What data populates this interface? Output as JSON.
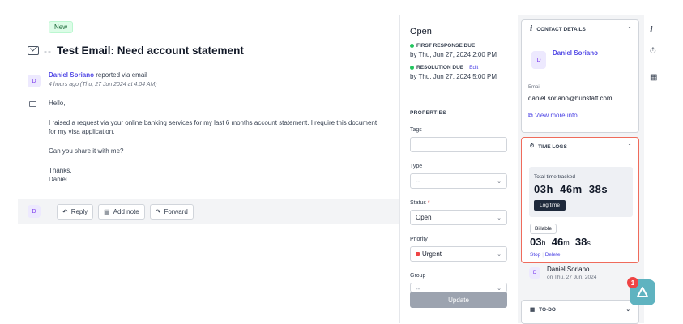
{
  "ticket": {
    "badge": "New",
    "subject": "Test Email: Need account statement",
    "reporter": {
      "initial": "D",
      "name": "Daniel Soriano",
      "action": " reported via email",
      "time": "4 hours ago (Thu, 27 Jun 2024 at 4:04 AM)"
    },
    "body": [
      "Hello,",
      "I raised a request via your online banking services for my last 6 months account statement. I require this document for my visa application.",
      "Can you share it with me?",
      "Thanks,\nDaniel"
    ],
    "actions": {
      "avatar": "D",
      "reply": "Reply",
      "add_note": "Add note",
      "forward": "Forward"
    }
  },
  "status_panel": {
    "status": "Open",
    "first_response": {
      "label": "FIRST RESPONSE DUE",
      "value": "by Thu, Jun 27, 2024 2:00 PM"
    },
    "resolution": {
      "label": "RESOLUTION DUE",
      "edit": "Edit",
      "value": "by Thu, Jun 27, 2024 5:00 PM"
    },
    "properties_heading": "PROPERTIES",
    "tags_label": "Tags",
    "type_label": "Type",
    "type_value": "--",
    "status_label": "Status",
    "status_value": "Open",
    "priority_label": "Priority",
    "priority_value": "Urgent",
    "group_label": "Group",
    "group_value": "--",
    "update_button": "Update"
  },
  "contact": {
    "heading": "CONTACT DETAILS",
    "avatar": "D",
    "name": "Daniel Soriano",
    "email_label": "Email",
    "email": "daniel.soriano@hubstaff.com",
    "more": "View more info"
  },
  "time_logs": {
    "heading": "TIME LOGS",
    "total_label": "Total time tracked",
    "total_value": "03h  46m  38s",
    "log_button": "Log time",
    "billable": "Billable",
    "bt_h": "03",
    "bt_m": "46",
    "bt_s": "38",
    "stop": "Stop",
    "delete": "Delete",
    "entry_avatar": "D",
    "entry_name": "Daniel Soriano",
    "entry_date": "on Thu, 27 Jun, 2024"
  },
  "todo": {
    "heading": "TO-DO"
  },
  "fab": {
    "badge": "1"
  }
}
